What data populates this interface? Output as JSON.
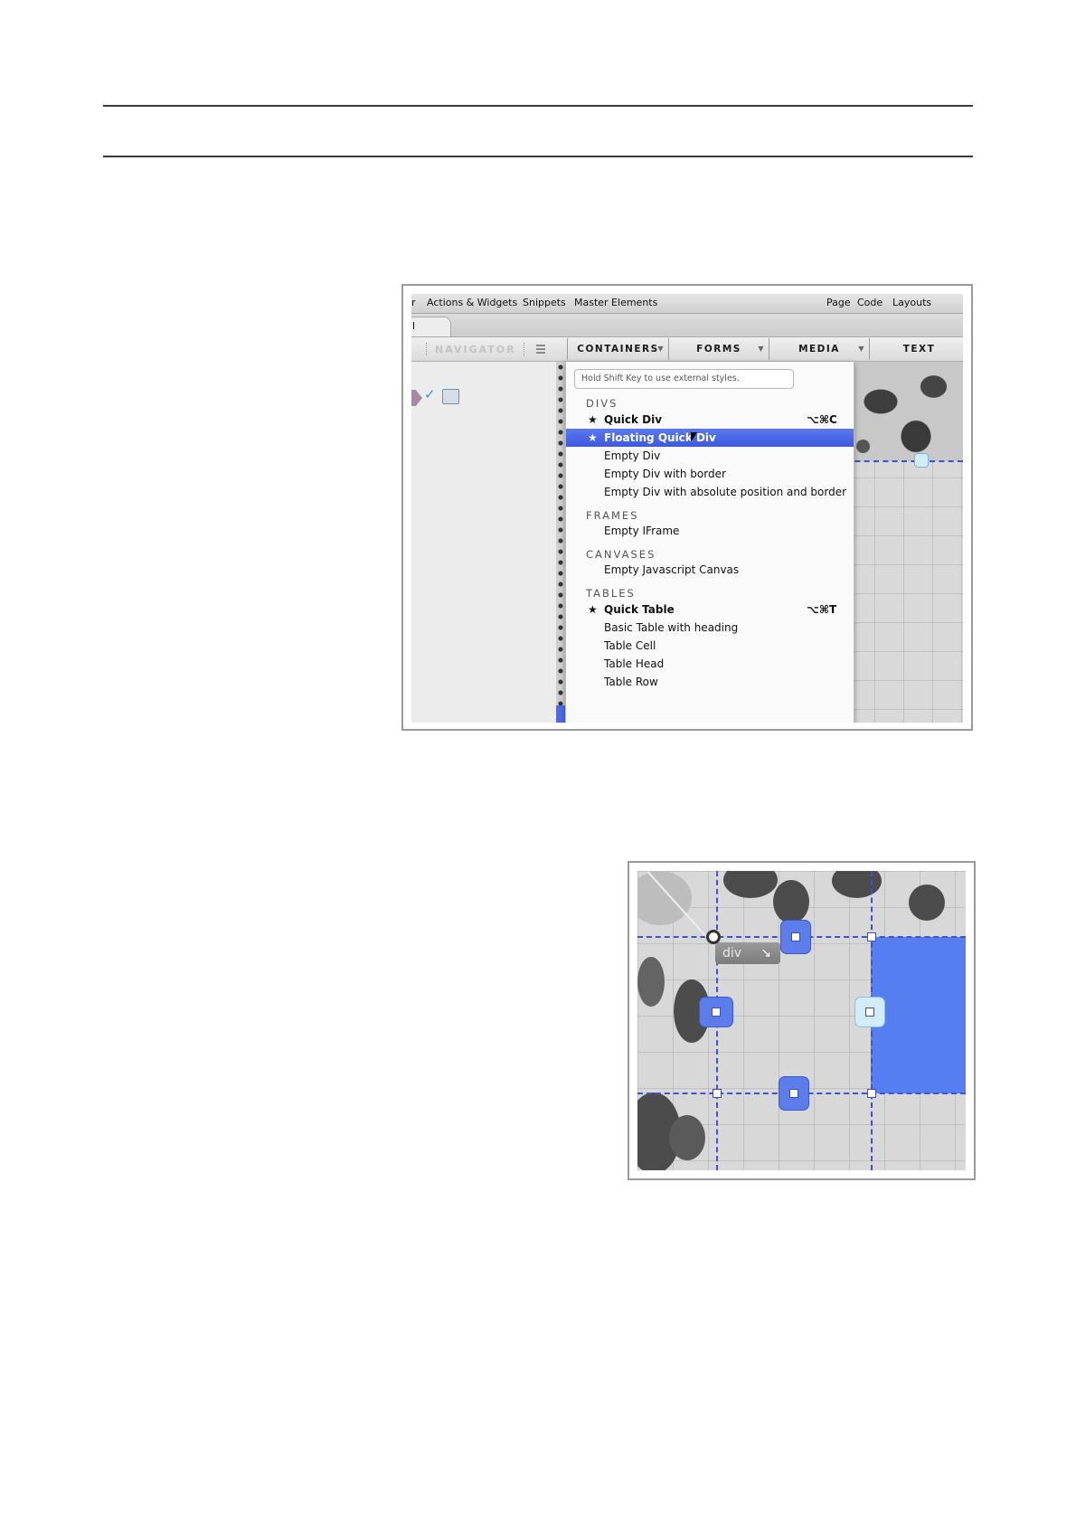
{
  "figure1": {
    "menubar": {
      "items": [
        "r",
        "Actions & Widgets",
        "Snippets",
        "Master Elements"
      ],
      "right_items": [
        "Page",
        "Code",
        "Layouts"
      ]
    },
    "document_tab": "l",
    "navigator_label": "NAVIGATOR",
    "panel_tabs": [
      "CONTAINERS",
      "FORMS",
      "MEDIA",
      "TEXT"
    ],
    "dropdown": {
      "hint": "Hold Shift Key to use external styles.",
      "headings": {
        "divs": "DIVS",
        "frames": "FRAMES",
        "canvases": "CANVASES",
        "tables": "TABLES"
      },
      "divs": [
        {
          "label": "Quick Div",
          "shortcut": "⌥⌘C",
          "starred": true
        },
        {
          "label": "Floating Quick Div",
          "starred": true,
          "selected": true
        },
        {
          "label": "Empty Div"
        },
        {
          "label": "Empty Div with border"
        },
        {
          "label": "Empty Div with absolute position and border"
        }
      ],
      "frames": [
        {
          "label": "Empty IFrame"
        }
      ],
      "canvases": [
        {
          "label": "Empty Javascript Canvas"
        }
      ],
      "tables": [
        {
          "label": "Quick Table",
          "shortcut": "⌥⌘T",
          "starred": true
        },
        {
          "label": "Basic Table with heading"
        },
        {
          "label": "Table Cell"
        },
        {
          "label": "Table Head"
        },
        {
          "label": "Table Row"
        }
      ]
    },
    "icons": [
      "star-icon",
      "check-icon",
      "cursor-icon",
      "list-icon",
      "dropdown-arrow-icon"
    ],
    "colors": {
      "selection": "#3c59df",
      "guide": "#3b4fd8"
    }
  },
  "figure2": {
    "div_label": "div",
    "div_arrow": "↘",
    "colors": {
      "selected_block": "#557ef0",
      "guide": "#4050dc"
    }
  }
}
